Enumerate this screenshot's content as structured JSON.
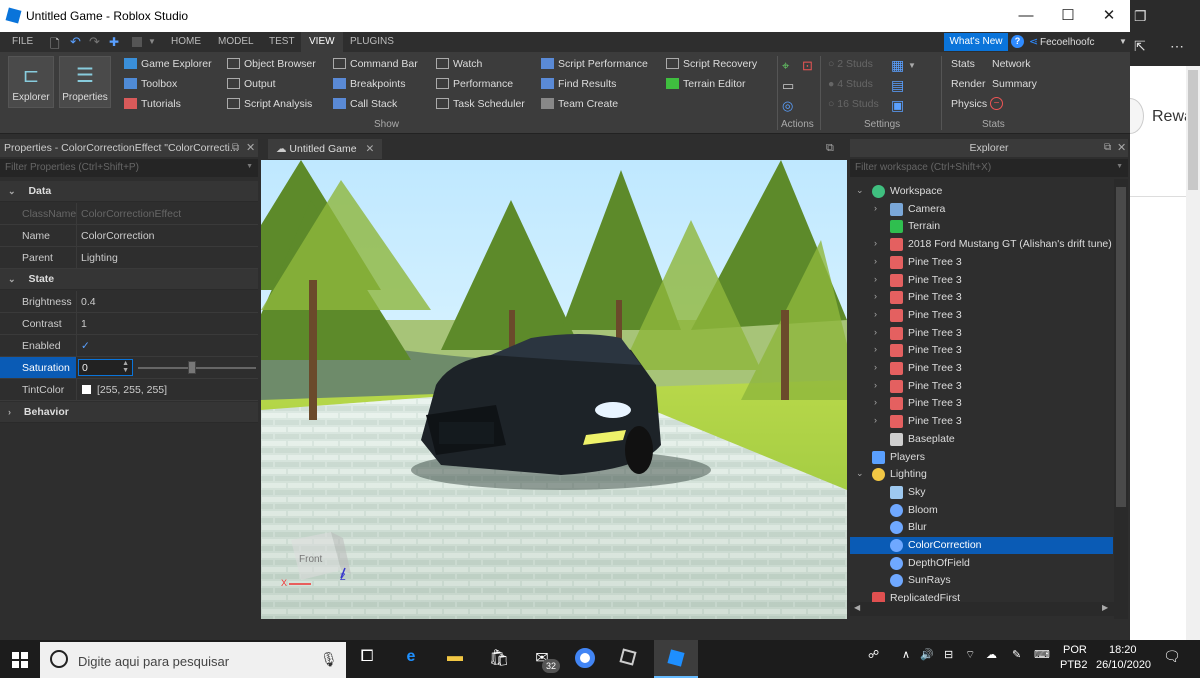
{
  "window": {
    "title": "Untitled Game - Roblox Studio"
  },
  "menu": {
    "tabs": [
      "FILE",
      "HOME",
      "MODEL",
      "TEST",
      "VIEW",
      "PLUGINS"
    ],
    "active_tab": "VIEW",
    "whats_new": "What's New",
    "username": "Fecoelhoofc"
  },
  "ribbon": {
    "explorer": "Explorer",
    "properties": "Properties",
    "show_col1": [
      "Game Explorer",
      "Toolbox",
      "Tutorials"
    ],
    "show_col2": [
      "Object Browser",
      "Output",
      "Script Analysis"
    ],
    "show_col3": [
      "Command Bar",
      "Breakpoints",
      "Call Stack"
    ],
    "show_col4": [
      "Watch",
      "Performance",
      "Task Scheduler"
    ],
    "show_col5": [
      "Script Performance",
      "Find Results",
      "Team Create"
    ],
    "show_col6": [
      "Script Recovery",
      "Terrain Editor"
    ],
    "show_label": "Show",
    "actions_label": "Actions",
    "studs": [
      "2 Studs",
      "4 Studs",
      "16 Studs"
    ],
    "settings_label": "Settings",
    "stats": [
      "Stats",
      "Network",
      "Render",
      "Summary",
      "Physics"
    ],
    "stats_label": "Stats"
  },
  "properties": {
    "header": "Properties - ColorCorrectionEffect \"ColorCorrecti...",
    "filter_placeholder": "Filter Properties (Ctrl+Shift+P)",
    "sections": {
      "data": "Data",
      "state": "State",
      "behavior": "Behavior"
    },
    "rows": {
      "classname": {
        "k": "ClassName",
        "v": "ColorCorrectionEffect"
      },
      "name": {
        "k": "Name",
        "v": "ColorCorrection"
      },
      "parent": {
        "k": "Parent",
        "v": "Lighting"
      },
      "brightness": {
        "k": "Brightness",
        "v": "0.4"
      },
      "contrast": {
        "k": "Contrast",
        "v": "1"
      },
      "enabled": {
        "k": "Enabled",
        "v": "✓"
      },
      "saturation": {
        "k": "Saturation",
        "v": "0",
        "slider_fraction": 0.46
      },
      "tintcolor": {
        "k": "TintColor",
        "v": "[255, 255, 255]"
      }
    }
  },
  "viewport": {
    "tab": "Untitled Game",
    "cube_label": "Front"
  },
  "explorer": {
    "header": "Explorer",
    "filter_placeholder": "Filter workspace (Ctrl+Shift+X)",
    "items": [
      {
        "label": "Workspace",
        "depth": 0,
        "chev": "v",
        "icon": "globe"
      },
      {
        "label": "Camera",
        "depth": 1,
        "chev": ">",
        "icon": "camera"
      },
      {
        "label": "Terrain",
        "depth": 1,
        "chev": "",
        "icon": "terrain"
      },
      {
        "label": "2018 Ford Mustang GT (Alishan's drift tune)",
        "depth": 1,
        "chev": ">",
        "icon": "model"
      },
      {
        "label": "Pine Tree 3",
        "depth": 1,
        "chev": ">",
        "icon": "model"
      },
      {
        "label": "Pine Tree 3",
        "depth": 1,
        "chev": ">",
        "icon": "model"
      },
      {
        "label": "Pine Tree 3",
        "depth": 1,
        "chev": ">",
        "icon": "model"
      },
      {
        "label": "Pine Tree 3",
        "depth": 1,
        "chev": ">",
        "icon": "model"
      },
      {
        "label": "Pine Tree 3",
        "depth": 1,
        "chev": ">",
        "icon": "model"
      },
      {
        "label": "Pine Tree 3",
        "depth": 1,
        "chev": ">",
        "icon": "model"
      },
      {
        "label": "Pine Tree 3",
        "depth": 1,
        "chev": ">",
        "icon": "model"
      },
      {
        "label": "Pine Tree 3",
        "depth": 1,
        "chev": ">",
        "icon": "model"
      },
      {
        "label": "Pine Tree 3",
        "depth": 1,
        "chev": ">",
        "icon": "model"
      },
      {
        "label": "Pine Tree 3",
        "depth": 1,
        "chev": ">",
        "icon": "model"
      },
      {
        "label": "Baseplate",
        "depth": 1,
        "chev": "",
        "icon": "part"
      },
      {
        "label": "Players",
        "depth": 0,
        "chev": "",
        "icon": "players"
      },
      {
        "label": "Lighting",
        "depth": 0,
        "chev": "v",
        "icon": "bulb"
      },
      {
        "label": "Sky",
        "depth": 1,
        "chev": "",
        "icon": "sky"
      },
      {
        "label": "Bloom",
        "depth": 1,
        "chev": "",
        "icon": "effect"
      },
      {
        "label": "Blur",
        "depth": 1,
        "chev": "",
        "icon": "effect"
      },
      {
        "label": "ColorCorrection",
        "depth": 1,
        "chev": "",
        "icon": "effect",
        "selected": true
      },
      {
        "label": "DepthOfField",
        "depth": 1,
        "chev": "",
        "icon": "effect"
      },
      {
        "label": "SunRays",
        "depth": 1,
        "chev": "",
        "icon": "effect"
      },
      {
        "label": "ReplicatedFirst",
        "depth": 0,
        "chev": "",
        "icon": "gift"
      }
    ]
  },
  "browser": {
    "partial_text": "Rewa"
  },
  "taskbar": {
    "search_placeholder": "Digite aqui para pesquisar",
    "mail_badge": "32",
    "lang": "POR",
    "lang2": "PTB2",
    "time": "18:20",
    "date": "26/10/2020"
  },
  "colors": {
    "accent": "#0a74da",
    "selection": "#0a5bb5",
    "panel": "#2e2e2e"
  }
}
